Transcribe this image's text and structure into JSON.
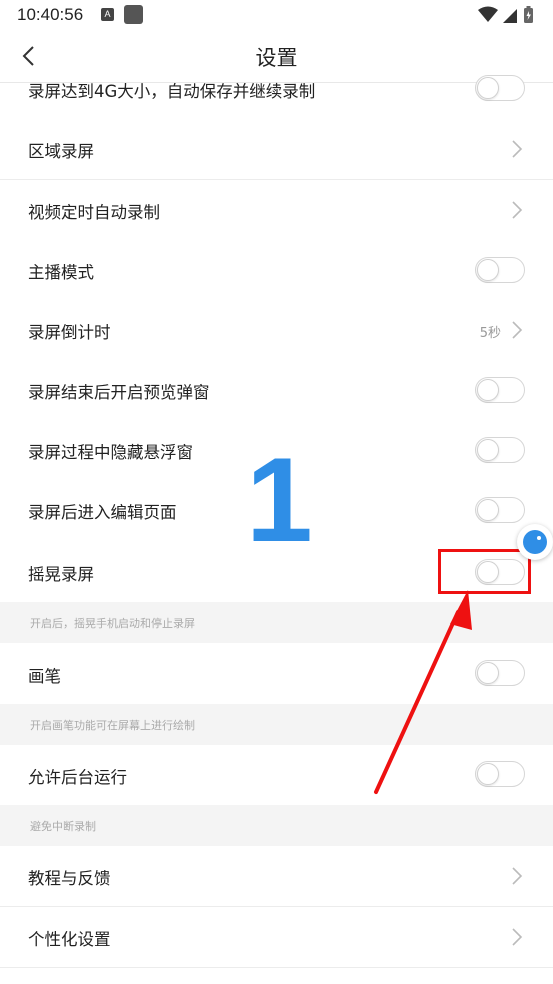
{
  "status_bar": {
    "time": "10:40:56",
    "notification_icon_letter": "A"
  },
  "nav": {
    "title": "设置"
  },
  "rows": {
    "record_4g": {
      "label": "录屏达到4G大小，自动保存并继续录制"
    },
    "area_record": {
      "label": "区域录屏"
    },
    "timed_record": {
      "label": "视频定时自动录制"
    },
    "anchor_mode": {
      "label": "主播模式"
    },
    "countdown": {
      "label": "录屏倒计时",
      "value": "5秒"
    },
    "preview_popup": {
      "label": "录屏结束后开启预览弹窗"
    },
    "hide_float": {
      "label": "录屏过程中隐藏悬浮窗"
    },
    "enter_edit": {
      "label": "录屏后进入编辑页面"
    },
    "shake_record": {
      "label": "摇晃录屏"
    },
    "brush": {
      "label": "画笔"
    },
    "background_run": {
      "label": "允许后台运行"
    },
    "tutorial": {
      "label": "教程与反馈"
    },
    "personalize": {
      "label": "个性化设置"
    }
  },
  "notes": {
    "shake": "开启后，摇晃手机启动和停止录屏",
    "brush": "开启画笔功能可在屏幕上进行绘制",
    "background": "避免中断录制"
  },
  "annotation": {
    "step_number": "1"
  },
  "colors": {
    "accent_blue": "#2f8ee6",
    "highlight_red": "#ee1111"
  }
}
